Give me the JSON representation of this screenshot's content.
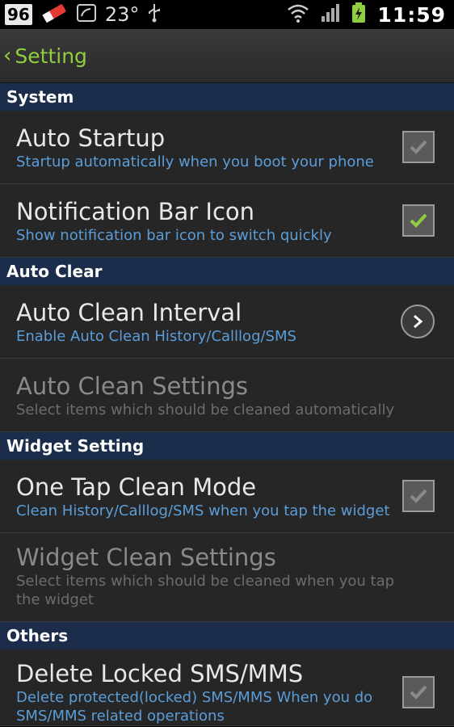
{
  "status_bar": {
    "battery_badge": "96",
    "temperature": "23°",
    "time": "11:59"
  },
  "action_bar": {
    "title": "Setting"
  },
  "sections": [
    {
      "header": "System",
      "items": [
        {
          "title": "Auto Startup",
          "subtitle": "Startup automatically when you boot your phone",
          "control": "checkbox",
          "checked": false,
          "enabled": true
        },
        {
          "title": "Notification Bar Icon",
          "subtitle": "Show notification bar icon to switch quickly",
          "control": "checkbox",
          "checked": true,
          "enabled": true
        }
      ]
    },
    {
      "header": "Auto Clear",
      "items": [
        {
          "title": "Auto Clean Interval",
          "subtitle": "Enable Auto Clean History/Calllog/SMS",
          "control": "chevron-button",
          "enabled": true
        },
        {
          "title": "Auto Clean Settings",
          "subtitle": "Select items which should be cleaned automatically",
          "control": "none",
          "enabled": false
        }
      ]
    },
    {
      "header": "Widget Setting",
      "items": [
        {
          "title": "One Tap Clean Mode",
          "subtitle": "Clean History/Calllog/SMS when you tap the widget",
          "control": "checkbox",
          "checked": false,
          "enabled": true
        },
        {
          "title": "Widget Clean Settings",
          "subtitle": "Select items which should be cleaned when you tap the widget",
          "control": "none",
          "enabled": false
        }
      ]
    },
    {
      "header": "Others",
      "items": [
        {
          "title": "Delete Locked SMS/MMS",
          "subtitle": "Delete protected(locked) SMS/MMS When you do SMS/MMS related operations",
          "control": "checkbox",
          "checked": false,
          "enabled": true
        }
      ]
    }
  ],
  "colors": {
    "accent_green": "#8fcf3f",
    "section_header_bg": "#1b2d4a",
    "subtitle_blue": "#5b9dd9"
  }
}
